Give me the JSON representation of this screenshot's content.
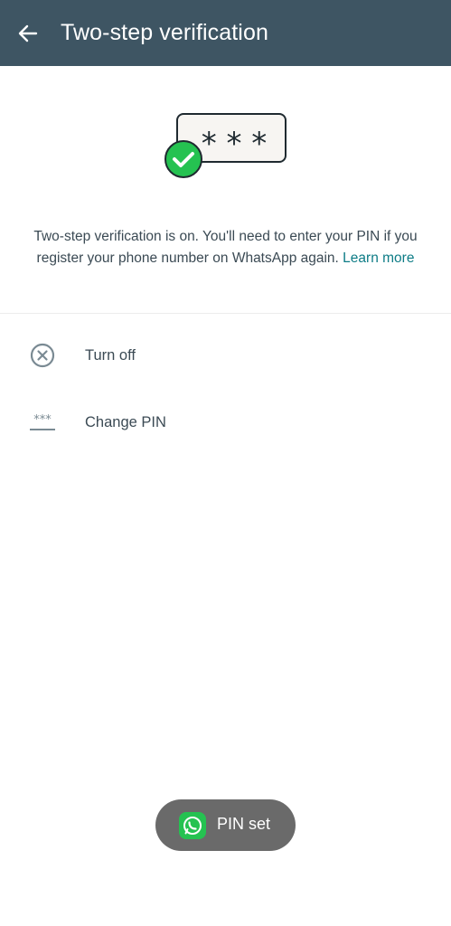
{
  "header": {
    "title": "Two-step verification"
  },
  "illustration": {
    "pin_mask": "* * *"
  },
  "info": {
    "text": "Two-step verification is on. You'll need to enter your PIN if you register your phone number on WhatsApp again. ",
    "link": "Learn more"
  },
  "actions": {
    "turn_off": "Turn off",
    "change_pin_icon": "***",
    "change_pin": "Change PIN"
  },
  "toast": {
    "text": "PIN set"
  },
  "colors": {
    "header_bg": "#3e5563",
    "accent_green": "#25c251",
    "link": "#0e7c86",
    "toast_bg": "#6a6a6a"
  },
  "icons": {
    "back": "arrow-left-icon",
    "check": "check-circle-icon",
    "turn_off": "close-circle-icon",
    "change_pin": "pin-dots-icon",
    "whatsapp": "whatsapp-icon"
  }
}
